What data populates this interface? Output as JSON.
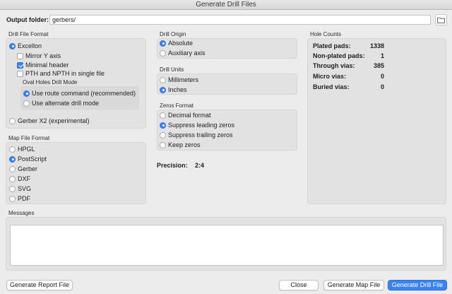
{
  "window": {
    "title": "Generate Drill Files"
  },
  "output": {
    "label": "Output folder:",
    "value": "gerbers/"
  },
  "drill_file_format": {
    "title": "Drill File Format",
    "excellon_label": "Excellon",
    "mirror_y_label": "Mirror Y axis",
    "minimal_header_label": "Minimal header",
    "pth_npth_label": "PTH and NPTH in single file",
    "oval_title": "Oval Holes Drill Mode",
    "route_label": "Use route command (recommended)",
    "alternate_label": "Use alternate drill mode",
    "gerber_x2_label": "Gerber X2 (experimental)"
  },
  "map_file_format": {
    "title": "Map File Format",
    "options": [
      "HPGL",
      "PostScript",
      "Gerber",
      "DXF",
      "SVG",
      "PDF"
    ],
    "selected": "PostScript"
  },
  "drill_origin": {
    "title": "Drill Origin",
    "options": [
      "Absolute",
      "Auxiliary axis"
    ],
    "selected": "Absolute"
  },
  "drill_units": {
    "title": "Drill Units",
    "options": [
      "Millimeters",
      "Inches"
    ],
    "selected": "Inches"
  },
  "zeros_format": {
    "title": "Zeros Format",
    "options": [
      "Decimal format",
      "Suppress leading zeros",
      "Suppress trailing zeros",
      "Keep zeros"
    ],
    "selected": "Suppress leading zeros"
  },
  "precision": {
    "label": "Precision:",
    "value": "2:4"
  },
  "hole_counts": {
    "title": "Hole Counts",
    "rows": [
      {
        "label": "Plated pads:",
        "value": "1338"
      },
      {
        "label": "Non-plated pads:",
        "value": "1"
      },
      {
        "label": "Through vias:",
        "value": "385"
      },
      {
        "label": "Micro vias:",
        "value": "0"
      },
      {
        "label": "Buried vias:",
        "value": "0"
      }
    ]
  },
  "messages": {
    "title": "Messages"
  },
  "buttons": {
    "report": "Generate Report File",
    "close": "Close",
    "map": "Generate Map File",
    "drill": "Generate Drill File"
  },
  "colors": {
    "accent": "#3b82f6",
    "background": "#ececec",
    "group": "#e2e2e2"
  },
  "icons": {
    "folder": "folder-icon"
  }
}
